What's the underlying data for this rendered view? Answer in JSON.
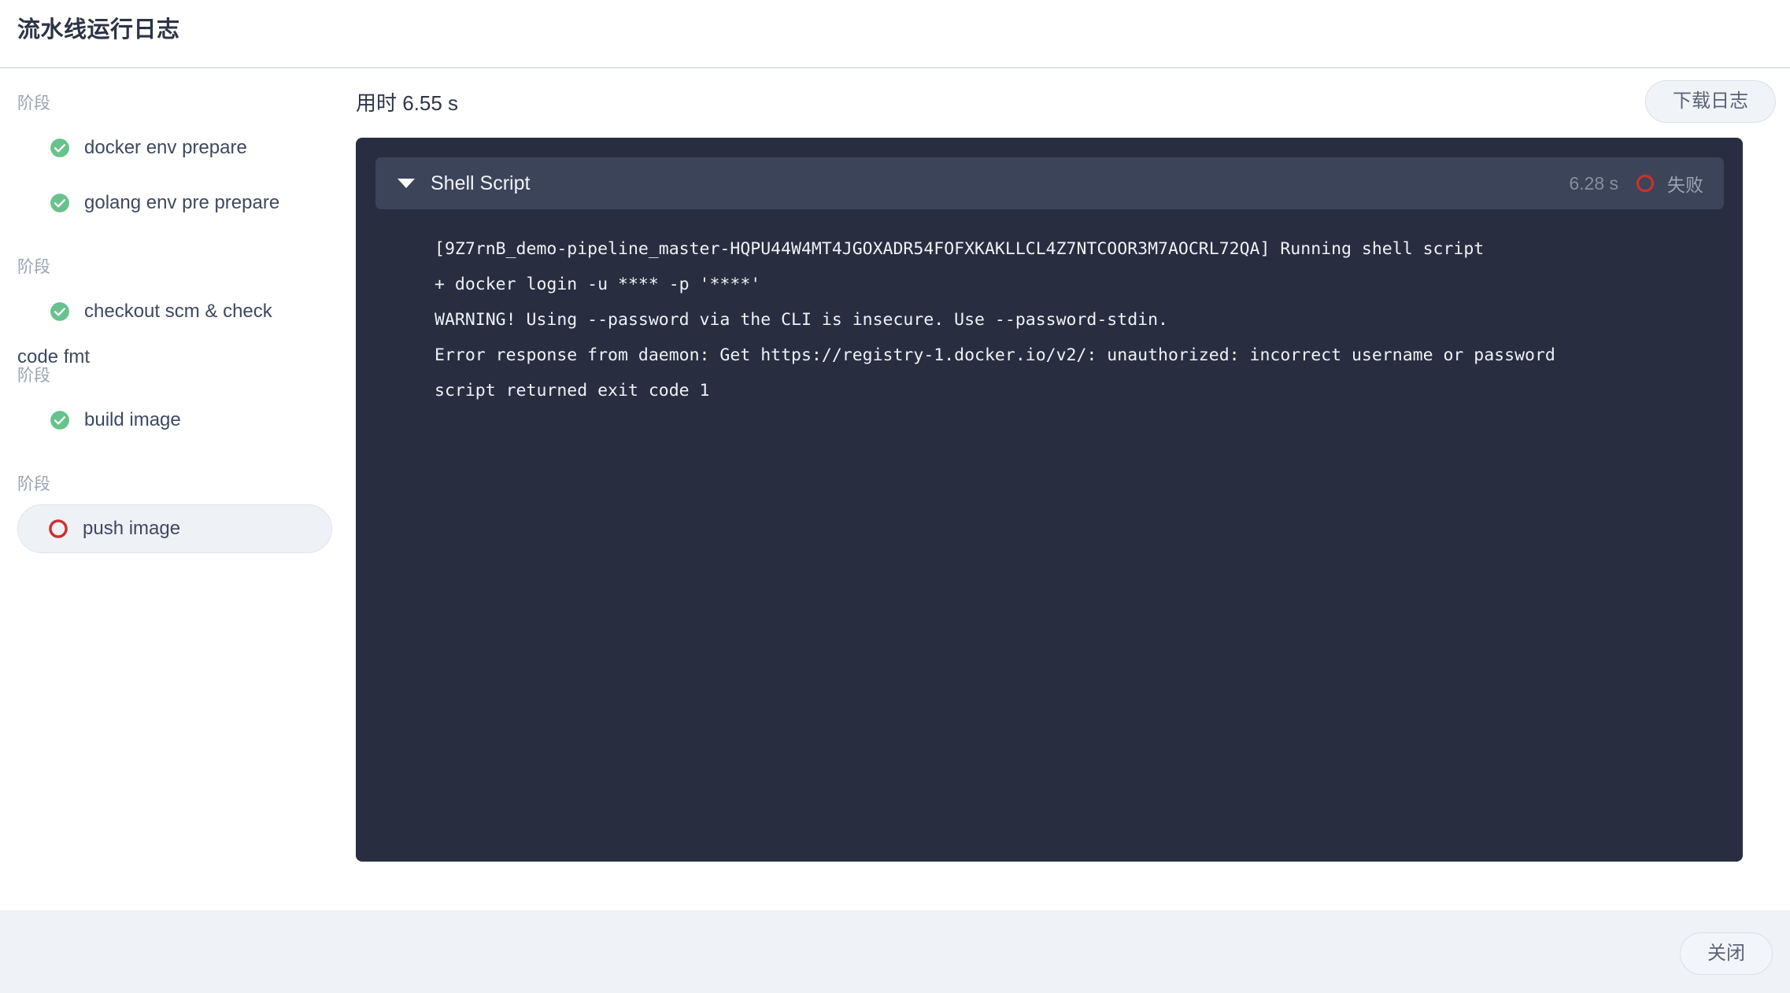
{
  "header": {
    "title": "流水线运行日志"
  },
  "sidebar": {
    "groups": [
      {
        "label": "阶段",
        "name": "",
        "items": [
          {
            "label": "docker env prepare",
            "status": "success",
            "selected": false
          },
          {
            "label": "golang env pre prepare",
            "status": "success",
            "selected": false
          }
        ]
      },
      {
        "label": "阶段",
        "name": "",
        "items": [
          {
            "label": "checkout scm & check",
            "status": "success",
            "selected": false
          }
        ]
      },
      {
        "label": "阶段",
        "name": "code fmt",
        "items": [
          {
            "label": "build image",
            "status": "success",
            "selected": false
          }
        ]
      },
      {
        "label": "阶段",
        "name": "",
        "items": [
          {
            "label": "push image",
            "status": "failed",
            "selected": true
          }
        ]
      }
    ]
  },
  "main": {
    "duration": "用时 6.55 s",
    "download_label": "下载日志",
    "step": {
      "name": "Shell Script",
      "time": "6.28 s",
      "status": "失败",
      "expanded": true
    },
    "log_lines": [
      "[9Z7rnB_demo-pipeline_master-HQPU44W4MT4JGOXADR54FOFXKAKLLCL4Z7NTCOOR3M7AOCRL72QA] Running shell script",
      "+ docker login -u **** -p '****'",
      "WARNING! Using --password via the CLI is insecure. Use --password-stdin.",
      "Error response from daemon: Get https://registry-1.docker.io/v2/: unauthorized: incorrect username or password",
      "script returned exit code 1"
    ]
  },
  "footer": {
    "close_label": "关闭"
  },
  "colors": {
    "success": "#67c28c",
    "failure": "#c9322a",
    "panel_bg": "#282e40",
    "step_header_bg": "#3b4459",
    "accent_text": "#3f4861"
  }
}
